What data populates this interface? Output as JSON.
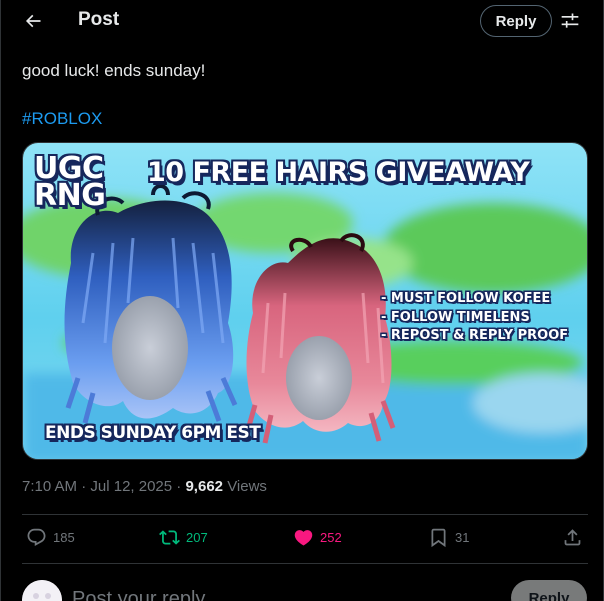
{
  "header": {
    "title": "Post",
    "reply_label": "Reply"
  },
  "tweet": {
    "text": "good luck! ends sunday!",
    "hashtag": "#ROBLOX",
    "media": {
      "ugc_line1": "UGC",
      "ugc_line2": "RNG",
      "title": "10 FREE HAIRS GIVEAWAY",
      "rules": [
        "- MUST FOLLOW KOFEE",
        "- FOLLOW TIMELENS",
        "- REPOST & REPLY PROOF"
      ],
      "footer": "ENDS SUNDAY 6PM EST"
    },
    "time": "7:10 AM",
    "date": "Jul 12, 2025",
    "views_count": "9,662",
    "views_label": "Views"
  },
  "actions": {
    "replies": "185",
    "reposts": "207",
    "likes": "252",
    "bookmarks": "31"
  },
  "composer": {
    "placeholder": "Post your reply",
    "submit_label": "Reply"
  },
  "colors": {
    "accent": "#1d9bf0",
    "repost": "#00ba7c",
    "like": "#f91880",
    "muted": "#71767b"
  },
  "icons": [
    "arrow-left-icon",
    "sliders-icon",
    "reply-icon",
    "repost-icon",
    "heart-icon",
    "bookmark-icon",
    "share-icon"
  ]
}
